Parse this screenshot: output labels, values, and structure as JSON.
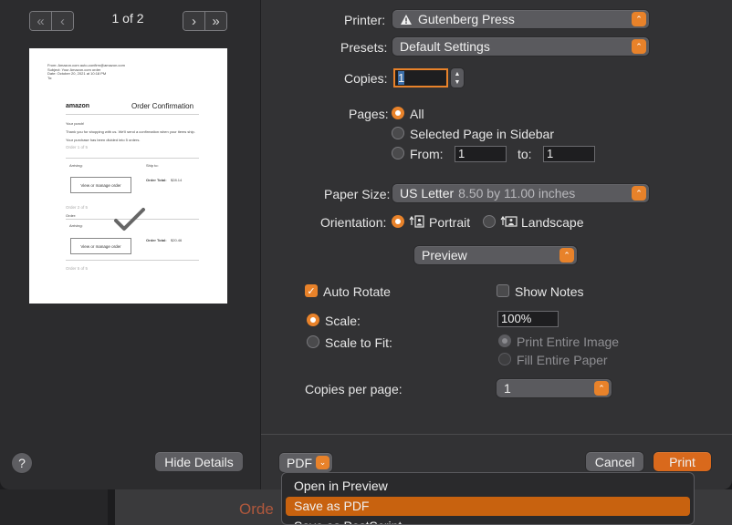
{
  "backdrop": {
    "doc_text": "Orde"
  },
  "nav": {
    "first_glyph": "«",
    "prev_glyph": "‹",
    "next_glyph": "›",
    "last_glyph": "»",
    "page_count": "1 of 2"
  },
  "preview": {
    "header_lines": [
      "From: Amazon.com auto-confirm@amazon.com",
      "Subject: Your Amazon.com order",
      "Date: October 20, 2021 at 10:18 PM",
      "To:"
    ],
    "logo": "amazon",
    "title": "Order Confirmation",
    "greeting": "Your porch!",
    "thanks": "Thank you for shopping with us. We'll send a confirmation when your items ship.",
    "divided": "Your purchase has been divided into 5 orders.",
    "order1": "Order 1 of 5",
    "arriving": "Arriving:",
    "ship_to": "Ship to:",
    "order_total": "Order Total:",
    "total1": "$28.14",
    "view_button": "View or manage order",
    "order2": "Order 2 of 5",
    "order_label": "Order:",
    "total2": "$20.46",
    "order5": "Order 5 of 5"
  },
  "help_glyph": "?",
  "hide_details": "Hide Details",
  "printer": {
    "label": "Printer:",
    "value": "Gutenberg Press",
    "warning_glyph": "!"
  },
  "presets": {
    "label": "Presets:",
    "value": "Default Settings"
  },
  "copies": {
    "label": "Copies:",
    "value": "1"
  },
  "pages": {
    "label": "Pages:",
    "all": "All",
    "selected": "Selected Page in Sidebar",
    "from": "From:",
    "from_value": "1",
    "to": "to:",
    "to_value": "1"
  },
  "paper_size": {
    "label": "Paper Size:",
    "value": "US Letter",
    "detail": "8.50 by 11.00 inches"
  },
  "orientation": {
    "label": "Orientation:",
    "portrait": "Portrait",
    "landscape": "Landscape"
  },
  "section_popup": "Preview",
  "auto_rotate": "Auto Rotate",
  "show_notes": "Show Notes",
  "scale": {
    "label": "Scale:",
    "value": "100%"
  },
  "scale_to_fit": "Scale to Fit:",
  "print_entire_image": "Print Entire Image",
  "fill_entire_paper": "Fill Entire Paper",
  "copies_per_page": {
    "label": "Copies per page:",
    "value": "1"
  },
  "footer": {
    "pdf": "PDF",
    "cancel": "Cancel",
    "print": "Print"
  },
  "pdf_menu": [
    "Open in Preview",
    "Save as PDF",
    "Save as PostScript"
  ],
  "accent_color": "#e8822a"
}
